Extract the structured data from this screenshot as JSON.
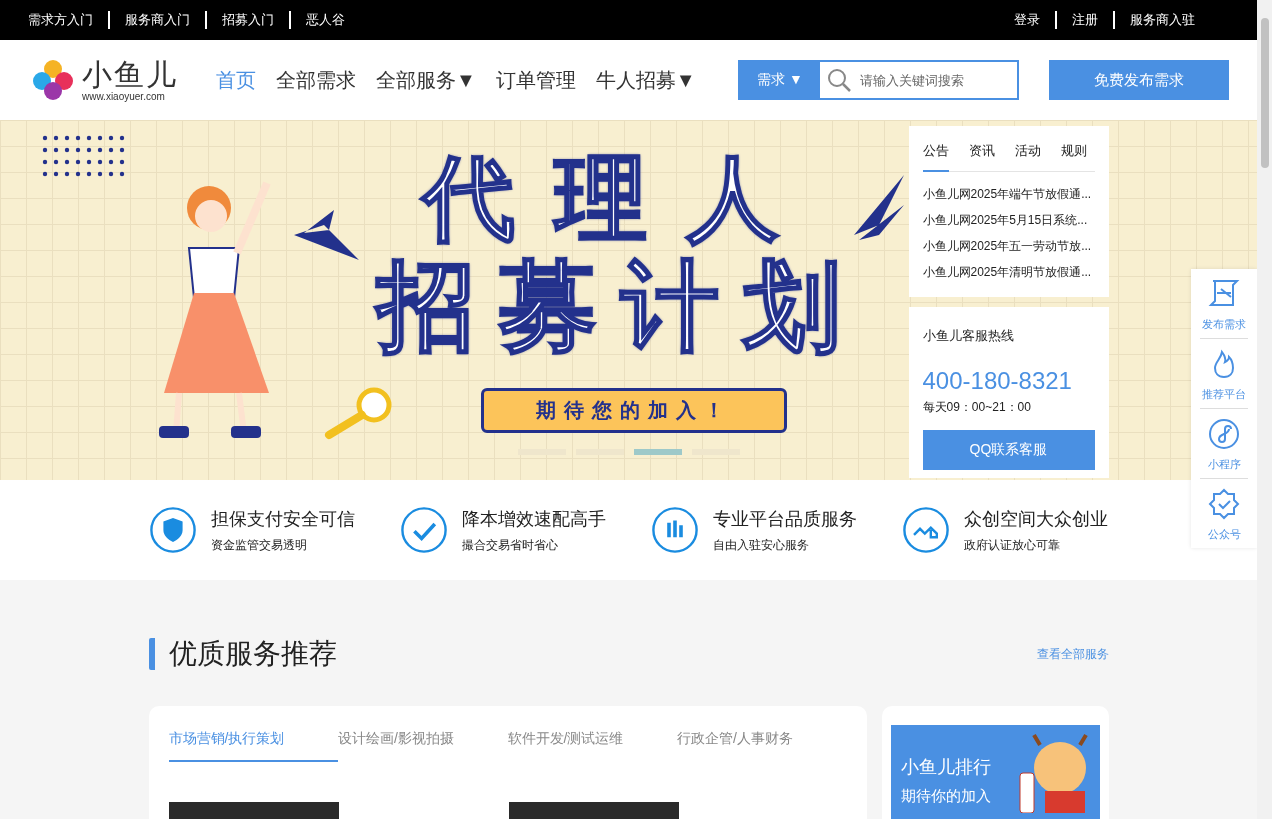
{
  "top_bar": {
    "left_links": [
      "需求方入门",
      "服务商入门",
      "招募入门",
      "恶人谷"
    ],
    "right_links": [
      "登录",
      "注册",
      "服务商入驻"
    ]
  },
  "header": {
    "logo": {
      "name": "小鱼儿",
      "url": "www.xiaoyuer.com"
    },
    "nav": [
      {
        "label": "首页",
        "selected": true
      },
      {
        "label": "全部需求",
        "selected": false
      },
      {
        "label": "全部服务▼",
        "selected": false
      },
      {
        "label": "订单管理",
        "selected": false
      },
      {
        "label": "牛人招募▼",
        "selected": false
      }
    ],
    "search": {
      "category": "需求 ▼",
      "placeholder": "请输入关键词搜索"
    },
    "publish_button": "免费发布需求"
  },
  "banner": {
    "title_lines": [
      "代理人",
      "招募计划"
    ],
    "ribbon": "期待您的加入！",
    "slides": [
      {
        "selected": false
      },
      {
        "selected": false
      },
      {
        "selected": true
      },
      {
        "selected": false
      }
    ]
  },
  "notice_panel": {
    "tabs": [
      {
        "label": "公告",
        "selected": true
      },
      {
        "label": "资讯",
        "selected": false
      },
      {
        "label": "活动",
        "selected": false
      },
      {
        "label": "规则",
        "selected": false
      }
    ],
    "items": [
      "小鱼儿网2025年端午节放假通...",
      "小鱼儿网2025年5月15日系统...",
      "小鱼儿网2025年五一劳动节放...",
      "小鱼儿网2025年清明节放假通..."
    ]
  },
  "hotline": {
    "title": "小鱼儿客服热线",
    "phone": "400-180-8321",
    "hours": "每天09：00~21：00",
    "button": "QQ联系客服"
  },
  "side_float": [
    "发布需求",
    "推荐平台",
    "小程序",
    "公众号"
  ],
  "features": [
    {
      "title": "担保支付安全可信",
      "subtitle": "资金监管交易透明"
    },
    {
      "title": "降本增效速配高手",
      "subtitle": "撮合交易省时省心"
    },
    {
      "title": "专业平台品质服务",
      "subtitle": "自由入驻安心服务"
    },
    {
      "title": "众创空间大众创业",
      "subtitle": "政府认证放心可靠"
    }
  ],
  "services": {
    "title": "优质服务推荐",
    "view_all": "查看全部服务",
    "tabs": [
      {
        "label": "市场营销/执行策划",
        "selected": true
      },
      {
        "label": "设计绘画/影视拍摄",
        "selected": false
      },
      {
        "label": "软件开发/测试运维",
        "selected": false
      },
      {
        "label": "行政企管/人事财务",
        "selected": false
      }
    ]
  },
  "ranking": {
    "title": "小鱼儿排行",
    "subtitle": "期待你的加入"
  }
}
